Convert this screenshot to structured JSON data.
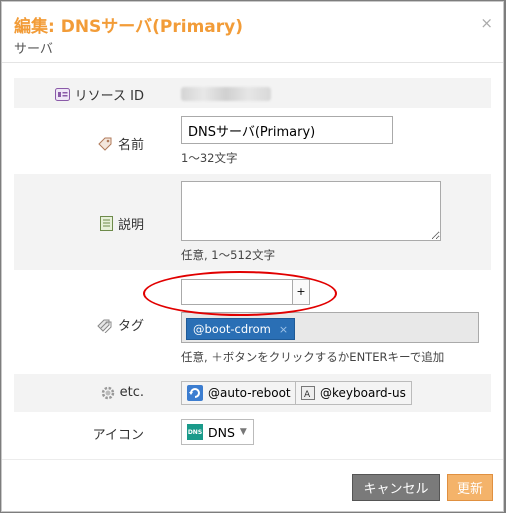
{
  "dialog": {
    "title": "編集: DNSサーバ(Primary)",
    "subtitle": "サーバ",
    "close": "×"
  },
  "fields": {
    "resource_id": {
      "label": "リソース ID"
    },
    "name": {
      "label": "名前",
      "value": "DNSサーバ(Primary)",
      "hint": "1〜32文字"
    },
    "description": {
      "label": "説明",
      "value": "",
      "hint": "任意, 1〜512文字"
    },
    "tags": {
      "label": "タグ",
      "input_value": "",
      "add_button": "+",
      "items": [
        "@boot-cdrom"
      ],
      "remove": "×",
      "hint": "任意, ＋ボタンをクリックするかENTERキーで追加"
    },
    "etc": {
      "label": "etc.",
      "buttons": [
        "@auto-reboot",
        "@keyboard-us"
      ]
    },
    "icon": {
      "label": "アイコン",
      "selected": "DNS",
      "logo_text": "DNS"
    }
  },
  "footer": {
    "cancel": "キャンセル",
    "update": "更新"
  },
  "colors": {
    "title": "#f29c38",
    "tag_chip": "#2a6fb5",
    "highlight_ellipse": "#e10000"
  }
}
